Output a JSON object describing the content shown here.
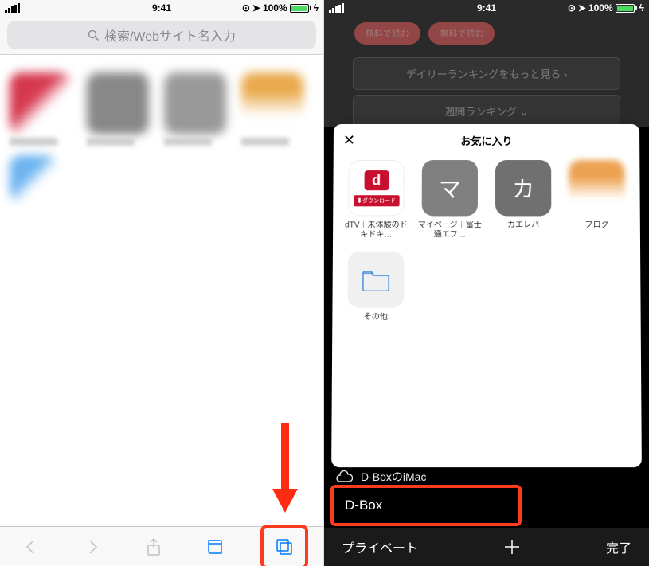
{
  "status": {
    "time": "9:41",
    "battery_pct": "100%"
  },
  "left": {
    "search_placeholder": "検索/Webサイト名入力"
  },
  "right": {
    "bg_chip1": "無料で読む",
    "bg_chip2": "無料で読む",
    "bg_row1": "デイリーランキングをもっと見る",
    "bg_row2": "週間ランキング",
    "favorites_title": "お気に入り",
    "items": [
      {
        "name": "dTV｜未体験のドキドキ…",
        "icon_text": "d",
        "badge": "ダウンロード"
      },
      {
        "name": "マイページ｜富士通エフ…",
        "icon_text": "マ"
      },
      {
        "name": "カエレバ",
        "icon_text": "カ"
      },
      {
        "name": "ブログ"
      },
      {
        "name": "その他"
      }
    ],
    "icloud_label": "D-BoxのiMac",
    "dbox_label": "D-Box",
    "toolbar": {
      "private": "プライベート",
      "done": "完了"
    }
  }
}
